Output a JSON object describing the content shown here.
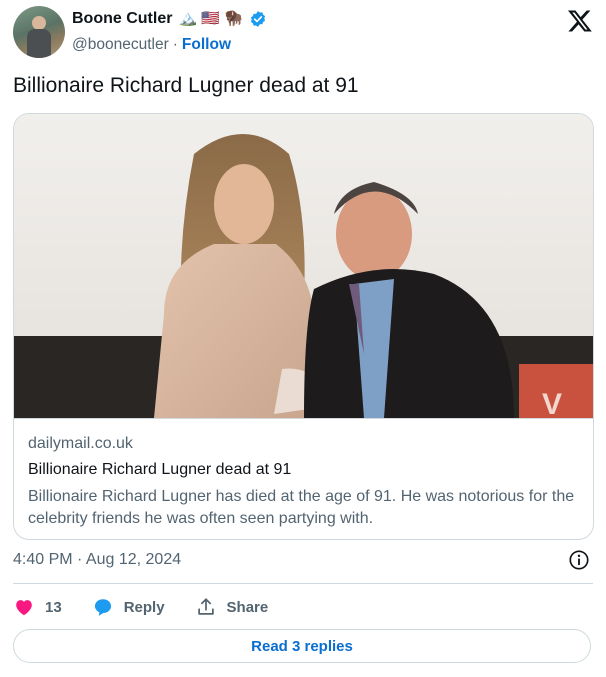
{
  "author": {
    "display_name": "Boone Cutler",
    "name_emojis": "🏔️ 🇺🇸 🦬",
    "handle": "@boonecutler",
    "separator": "·",
    "follow_label": "Follow"
  },
  "tweet": {
    "text": "Billionaire Richard Lugner dead at 91"
  },
  "link_card": {
    "domain": "dailymail.co.uk",
    "title": "Billionaire Richard Lugner dead at 91",
    "description": "Billionaire Richard Lugner has died at the age of 91. He was notorious for the celebrity friends he was often seen partying with."
  },
  "meta": {
    "timestamp": "4:40 PM · Aug 12, 2024"
  },
  "actions": {
    "like_count": "13",
    "reply_label": "Reply",
    "share_label": "Share"
  },
  "read_replies_label": "Read 3 replies",
  "colors": {
    "link_blue": "#0a6ed1",
    "verified_blue": "#1d9bf0",
    "heart_pink": "#f91880",
    "muted_text": "#536471",
    "border": "#cfd9de"
  },
  "icons": [
    "verified-badge-icon",
    "x-logo-icon",
    "info-icon",
    "heart-icon",
    "reply-bubble-icon",
    "share-icon"
  ]
}
